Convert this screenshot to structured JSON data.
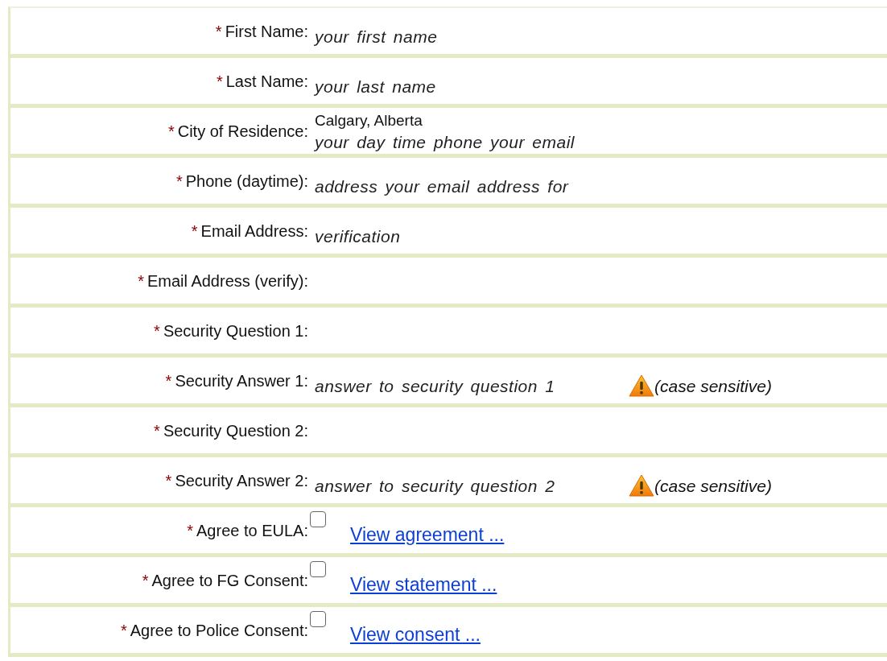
{
  "rows": [
    {
      "marker": "*",
      "label": "First Name:",
      "hint": "your first name"
    },
    {
      "marker": "*",
      "label": "Last Name:",
      "hint": "your last name"
    },
    {
      "marker": "*",
      "label": "City of Residence:",
      "value": "Calgary, Alberta",
      "hint": "your day time phone your email"
    },
    {
      "marker": "*",
      "label": "Phone (daytime):",
      "hint": "address your email address for"
    },
    {
      "marker": "*",
      "label": "Email Address:",
      "hint": "verification"
    },
    {
      "marker": "*",
      "label": "Email Address (verify):"
    },
    {
      "marker": "*",
      "label": "Security Question 1:"
    },
    {
      "marker": "*",
      "label": "Security Answer 1:",
      "hint": "answer to security question 1",
      "note": "(case sensitive)"
    },
    {
      "marker": "*",
      "label": "Security Question 2:"
    },
    {
      "marker": "*",
      "label": "Security Answer 2:",
      "hint": "answer to security question 2",
      "note": "(case sensitive)"
    },
    {
      "marker": "*",
      "label": "Agree to EULA:",
      "checkbox": {
        "checked": false
      },
      "link": "View agreement ..."
    },
    {
      "marker": "*",
      "label": "Agree to FG Consent:",
      "checkbox": {
        "checked": false
      },
      "link": "View statement ..."
    },
    {
      "marker": "*",
      "label": "Agree to Police Consent:",
      "checkbox": {
        "checked": false
      },
      "link": "View consent ..."
    }
  ]
}
